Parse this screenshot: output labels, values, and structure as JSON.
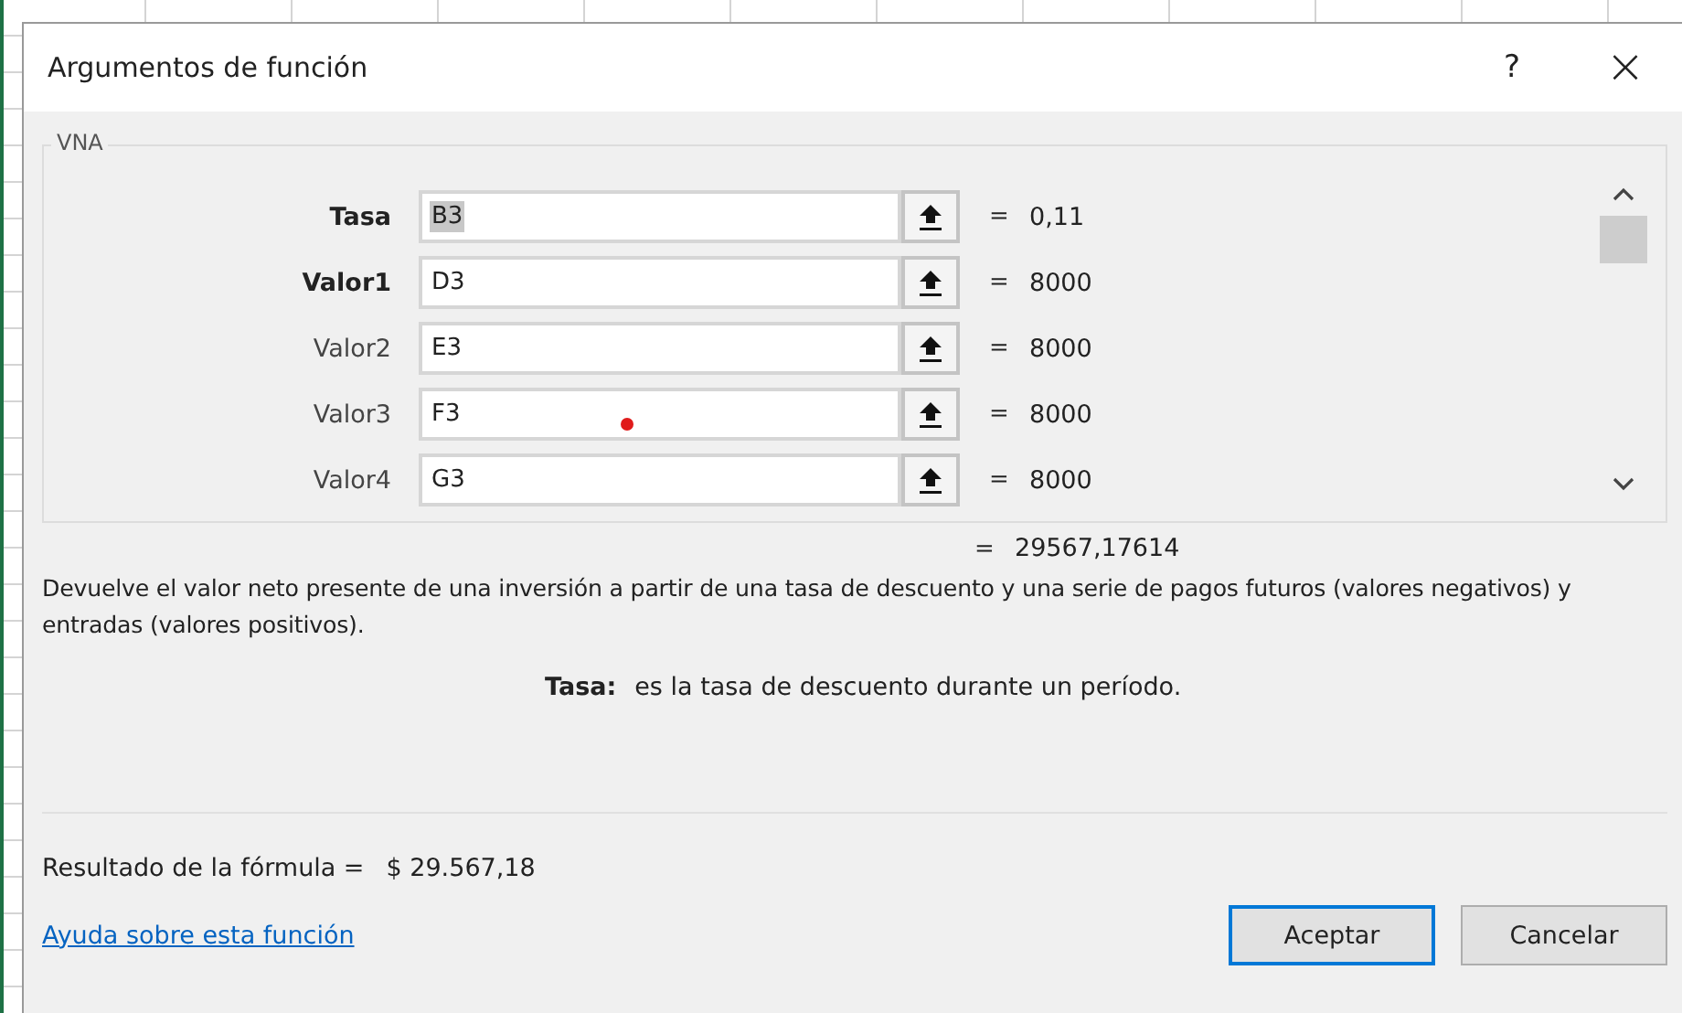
{
  "window": {
    "title": "Argumentos de función",
    "help_button": "?",
    "close_button": "×"
  },
  "function_group": {
    "name": "VNA",
    "arguments": [
      {
        "label": "Tasa",
        "required": true,
        "value": "B3",
        "highlighted": true,
        "marker": false,
        "equals": "=",
        "result": "0,11"
      },
      {
        "label": "Valor1",
        "required": true,
        "value": "D3",
        "highlighted": false,
        "marker": false,
        "equals": "=",
        "result": "8000"
      },
      {
        "label": "Valor2",
        "required": false,
        "value": "E3",
        "highlighted": false,
        "marker": false,
        "equals": "=",
        "result": "8000"
      },
      {
        "label": "Valor3",
        "required": false,
        "value": "F3",
        "highlighted": false,
        "marker": true,
        "equals": "=",
        "result": "8000"
      },
      {
        "label": "Valor4",
        "required": false,
        "value": "G3",
        "highlighted": false,
        "marker": false,
        "equals": "=",
        "result": "8000"
      }
    ]
  },
  "function_result": {
    "equals": "=",
    "value": "29567,17614"
  },
  "description": "Devuelve el valor neto presente de una inversión a partir de una tasa de descuento y una serie de pagos futuros (valores negativos) y entradas (valores positivos).",
  "argument_help": {
    "name": "Tasa:",
    "text": "es la tasa de descuento durante un período."
  },
  "formula_result": {
    "label": "Resultado de la fórmula =",
    "value": "$ 29.567,18"
  },
  "help_link": "Ayuda sobre esta función",
  "buttons": [
    {
      "label": "Aceptar",
      "default": true
    },
    {
      "label": "Cancelar",
      "default": false
    }
  ]
}
